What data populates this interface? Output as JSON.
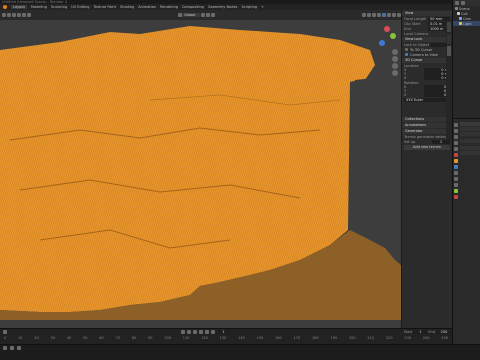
{
  "titlebar": {
    "title": "Untitled (Unsaved Scene) - Blender 4"
  },
  "menubar": {
    "workspaces": [
      "Layout",
      "Modeling",
      "Sculpting",
      "UV Editing",
      "Texture Paint",
      "Shading",
      "Animation",
      "Rendering",
      "Compositing",
      "Geometry Nodes",
      "Scripting"
    ]
  },
  "viewport_header": {
    "transform_orientation": "Global"
  },
  "gizmo_colors": {
    "x": "#e04b5a",
    "y": "#8ac33a",
    "z": "#3e7ad6"
  },
  "npanel": {
    "view_section": "View",
    "focal_label": "Focal Length",
    "focal_value": "50 mm",
    "clip_label": "Clip Start",
    "clip_value": "0.01 m",
    "end_label": "End",
    "end_value": "1000 m",
    "collection_label": "Local Camera",
    "lock_section": "View Lock",
    "lock_label": "Lock to Object",
    "lock_to_cursor": "To 3D Cursor",
    "lock_camera": "Camera to View",
    "cursor_section": "3D Cursor",
    "location_label": "Location",
    "axis_x": "X",
    "axis_y": "Y",
    "axis_z": "Z",
    "loc_x": "0 m",
    "loc_y": "0 m",
    "loc_z": "0 m",
    "rotation_label": "Rotation",
    "rot_x": "0°",
    "rot_y": "0°",
    "rot_z": "0°",
    "rotation_mode": "XYZ Euler",
    "collections_section": "Collections",
    "annotations_section": "Annotations",
    "generator_section": "Generator",
    "generator_text": "Terrain generator settings",
    "use_label": "Set up",
    "use_value": "1",
    "generate_button": "Add new terrain"
  },
  "outliner": {
    "items": [
      "Scene",
      "Coll",
      "Cam",
      "Light"
    ]
  },
  "timeline": {
    "frame_current": "1",
    "start_label": "Start",
    "start_value": "1",
    "end_label": "End",
    "end_value": "250",
    "ruler": [
      "0",
      "10",
      "20",
      "30",
      "40",
      "50",
      "60",
      "70",
      "80",
      "90",
      "100",
      "110",
      "120",
      "130",
      "140",
      "150",
      "160",
      "170",
      "180",
      "190",
      "200",
      "210",
      "220",
      "230",
      "240",
      "250"
    ]
  },
  "terrain": {
    "color": "#e8952b",
    "background": "#3d3d3d"
  }
}
